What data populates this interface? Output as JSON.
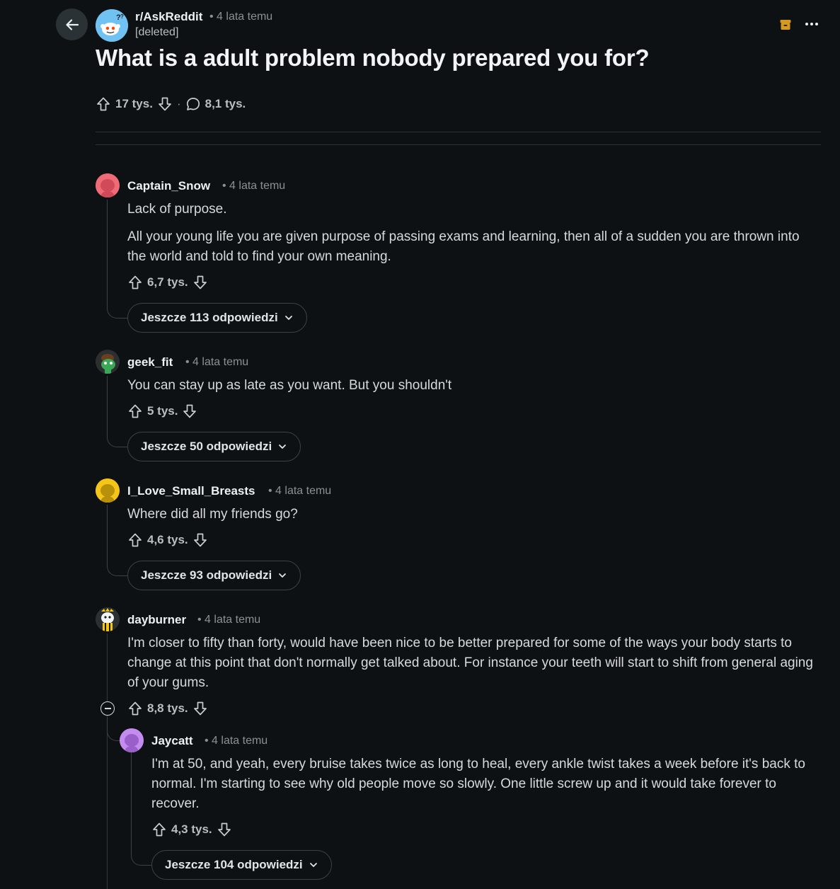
{
  "header": {
    "subreddit": "r/AskReddit",
    "post_time": "• 4 lata temu",
    "author": "[deleted]",
    "title": "What is a adult problem nobody prepared you for?",
    "upvotes": "17 tys.",
    "separator": "·",
    "comments": "8,1 tys."
  },
  "comments": [
    {
      "user": "Captain_Snow",
      "time": "• 4 lata temu",
      "paragraphs": [
        "Lack of purpose.",
        "All your young life you are given purpose of passing exams and learning, then all of a sudden you are thrown into the world and told to find your own meaning."
      ],
      "votes": "6,7 tys.",
      "more": "Jeszcze 113 odpowiedzi"
    },
    {
      "user": "geek_fit",
      "time": "• 4 lata temu",
      "text": "You can stay up as late as you want. But you shouldn't",
      "votes": "5 tys.",
      "more": "Jeszcze 50 odpowiedzi"
    },
    {
      "user": "I_Love_Small_Breasts",
      "time": "• 4 lata temu",
      "text": "Where did all my friends go?",
      "votes": "4,6 tys.",
      "more": "Jeszcze 93 odpowiedzi"
    },
    {
      "user": "dayburner",
      "time": "• 4 lata temu",
      "text": "I'm closer to fifty than forty, would have been nice to be better prepared for some of the ways your body starts to change at this point that don't normally get talked about. For instance your teeth will start to shift from general aging of your gums.",
      "votes": "8,8 tys."
    }
  ],
  "reply": {
    "user": "Jaycatt",
    "time": "• 4 lata temu",
    "text": "I'm at 50, and yeah, every bruise takes twice as long to heal, every ankle twist takes a week before it's back to normal. I'm starting to see why old people move so slowly. One little screw up and it would take forever to recover.",
    "votes": "4,3 tys.",
    "more": "Jeszcze 104 odpowiedzi"
  },
  "icons": {
    "back": "arrow-left-icon",
    "archive": "archive-icon",
    "more": "ellipsis-icon",
    "upvote": "arrow-up-icon",
    "downvote": "arrow-down-icon",
    "comment": "speech-bubble-icon",
    "expand": "chevron-down-icon",
    "collapse": "minus-circle-icon"
  },
  "colors": {
    "background": "#0e1113",
    "archive_accent": "#d49a1f"
  }
}
